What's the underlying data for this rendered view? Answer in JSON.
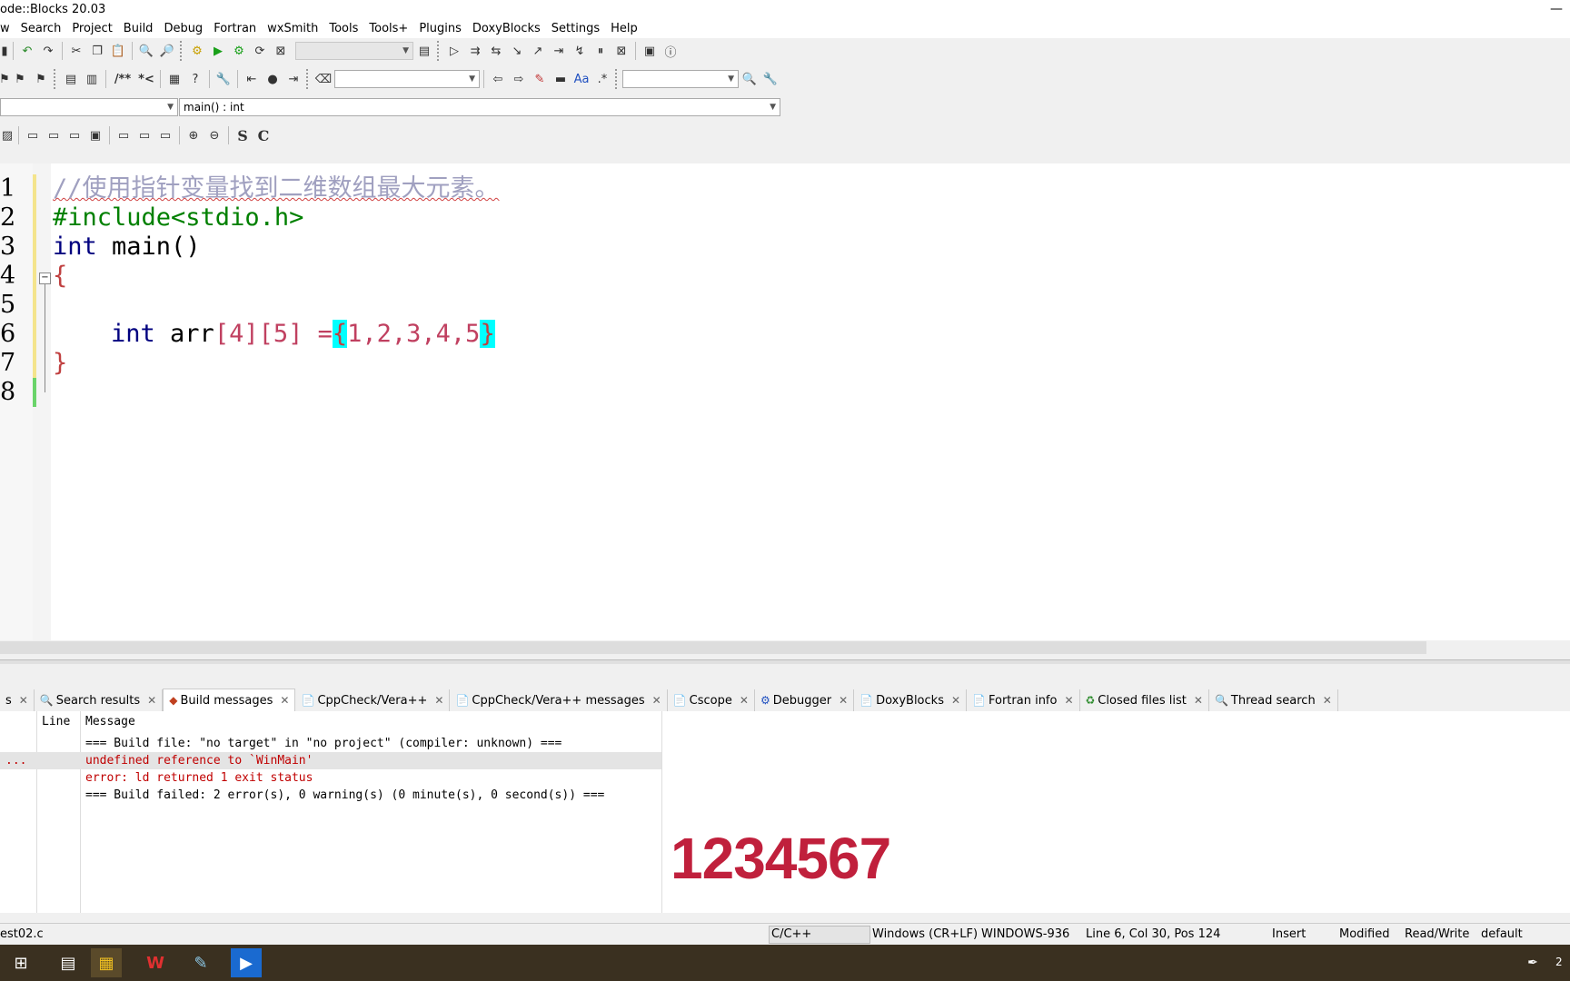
{
  "window": {
    "title": "ode::Blocks 20.03",
    "minimize": "—"
  },
  "menu": [
    "w",
    "Search",
    "Project",
    "Build",
    "Debug",
    "Fortran",
    "wxSmith",
    "Tools",
    "Tools+",
    "Plugins",
    "DoxyBlocks",
    "Settings",
    "Help"
  ],
  "toolbar3": {
    "function_combo": "main() : int",
    "comment_btn": "/**",
    "uncomment_btn": "*<"
  },
  "toolbar4": {
    "s_btn": "S",
    "c_btn": "C"
  },
  "editor": {
    "line_numbers": [
      "1",
      "2",
      "3",
      "4",
      "5",
      "6",
      "7",
      "8"
    ],
    "lines": {
      "l1_comment": "//使用指针变量找到二维数组最大元素。",
      "l2_include": "#include<stdio.h>",
      "l3_kw": "int",
      "l3_rest": " main()",
      "l4_brace": "{",
      "l6_kw": "int",
      "l6_name": " arr",
      "l6_dims": "[4][5]",
      "l6_eq": " =",
      "l6_open": "{",
      "l6_vals": "1,2,3,4,5",
      "l6_close": "}",
      "l7_brace": "}"
    }
  },
  "tabs": [
    {
      "label": "s",
      "icon": ""
    },
    {
      "label": "Search results",
      "icon": "search-icon"
    },
    {
      "label": "Build messages",
      "icon": "build-icon",
      "active": true
    },
    {
      "label": "CppCheck/Vera++",
      "icon": "doc-icon"
    },
    {
      "label": "CppCheck/Vera++ messages",
      "icon": "doc-icon"
    },
    {
      "label": "Cscope",
      "icon": "doc-icon"
    },
    {
      "label": "Debugger",
      "icon": "gear-icon"
    },
    {
      "label": "DoxyBlocks",
      "icon": "doc-icon"
    },
    {
      "label": "Fortran info",
      "icon": "doc-icon"
    },
    {
      "label": "Closed files list",
      "icon": "recycle-icon"
    },
    {
      "label": "Thread search",
      "icon": "search-icon"
    }
  ],
  "log": {
    "col_line": "Line",
    "col_message": "Message",
    "file_cell": "...",
    "messages": [
      "=== Build file: \"no target\" in \"no project\" (compiler: unknown) ===",
      "undefined reference to `WinMain'",
      "error: ld returned 1 exit status",
      "=== Build failed: 2 error(s), 0 warning(s) (0 minute(s), 0 second(s)) ==="
    ],
    "overlay": "1234567"
  },
  "status": {
    "file": "est02.c",
    "language": "C/C++",
    "eol": "Windows (CR+LF)",
    "encoding": "WINDOWS-936",
    "position": "Line 6, Col 30, Pos 124",
    "mode": "Insert",
    "modified": "Modified",
    "access": "Read/Write",
    "profile": "default"
  },
  "taskbar": {
    "clock": "2"
  }
}
